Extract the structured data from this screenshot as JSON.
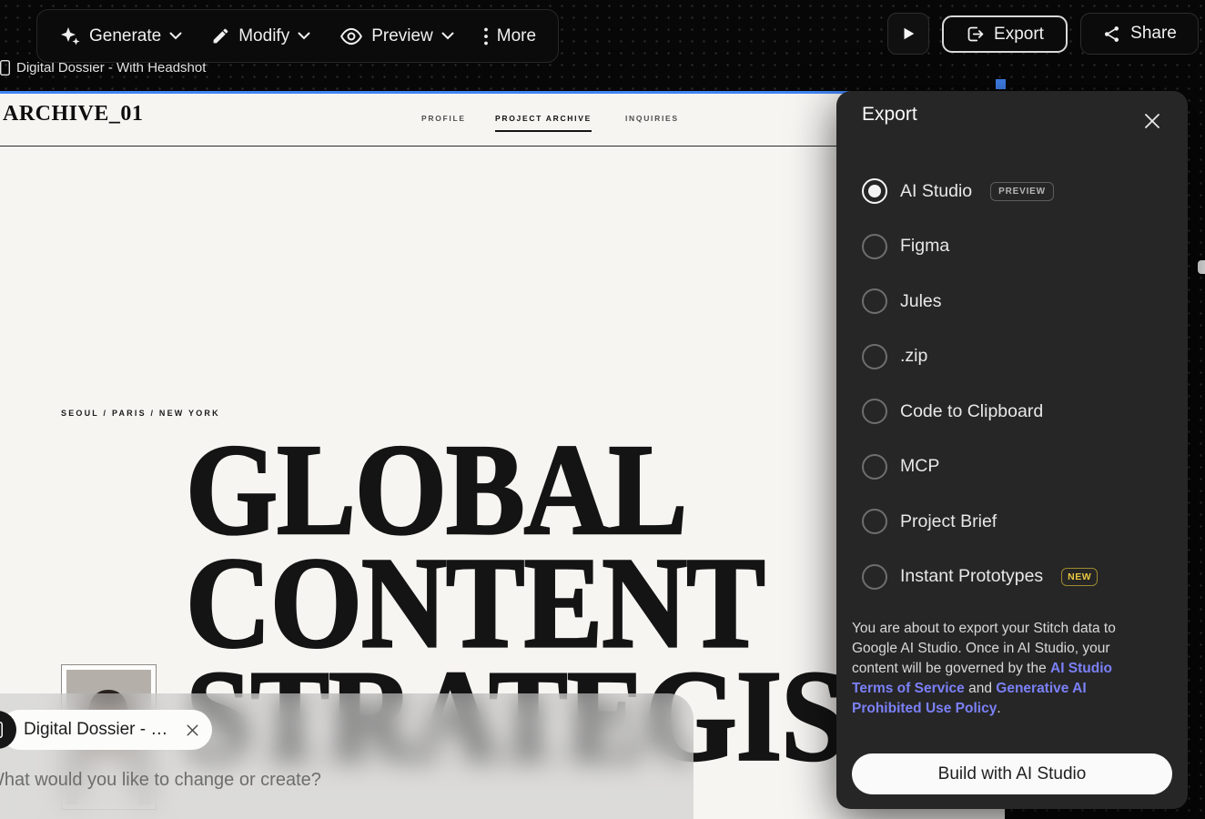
{
  "colors": {
    "accent": "#4285f4",
    "link": "#7b80f7",
    "badge_new": "#e8c63e",
    "canvas_bg": "#f7f5f2",
    "panel_bg": "#262626",
    "build_button_bg": "#fafafa"
  },
  "toolbar": {
    "generate_label": "Generate",
    "modify_label": "Modify",
    "preview_label": "Preview",
    "more_label": "More",
    "export_label": "Export",
    "share_label": "Share"
  },
  "frame": {
    "label": "Digital Dossier - With Headshot"
  },
  "canvas": {
    "site": {
      "logo": "ARCHIVE_01",
      "nav": [
        "PROFILE",
        "PROJECT ARCHIVE",
        "INQUIRIES"
      ],
      "active_nav": "PROJECT ARCHIVE",
      "locations": "SEOUL / PARIS / NEW YORK",
      "headline_lines": [
        "GLOBAL",
        "CONTENT",
        "STRATEGIST"
      ]
    }
  },
  "export_panel": {
    "title": "Export",
    "options": [
      {
        "label": "AI Studio",
        "badge": "PREVIEW",
        "selected": true
      },
      {
        "label": "Figma",
        "badge": null,
        "selected": false
      },
      {
        "label": "Jules",
        "badge": null,
        "selected": false
      },
      {
        "label": ".zip",
        "badge": null,
        "selected": false
      },
      {
        "label": "Code to Clipboard",
        "badge": null,
        "selected": false
      },
      {
        "label": "MCP",
        "badge": null,
        "selected": false
      },
      {
        "label": "Project Brief",
        "badge": null,
        "selected": false
      },
      {
        "label": "Instant Prototypes",
        "badge": "NEW",
        "selected": false
      }
    ],
    "disclaimer_segments": [
      {
        "type": "text",
        "text": "You are about to export your Stitch data to Google AI Studio. Once in AI Studio, your content will be governed by the "
      },
      {
        "type": "link",
        "text": "AI Studio Terms of Service"
      },
      {
        "type": "text",
        "text": " and "
      },
      {
        "type": "link",
        "text": "Generative AI Prohibited Use Policy"
      },
      {
        "type": "text",
        "text": "."
      }
    ],
    "build_button_label": "Build with AI Studio"
  },
  "chat": {
    "chip_label": "Digital Dossier - With Headshot",
    "placeholder": "What would you like to change or create?"
  }
}
